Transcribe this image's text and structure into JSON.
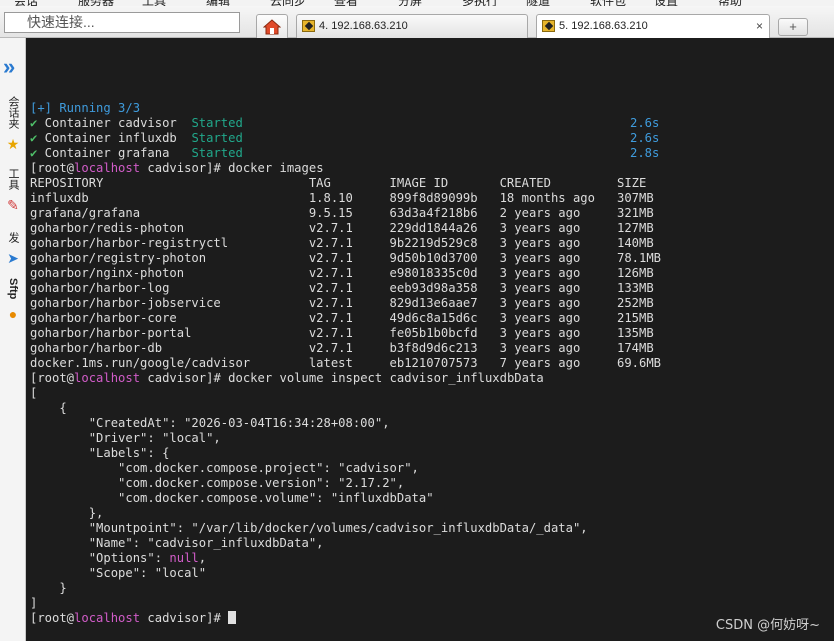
{
  "menubar": [
    "会话",
    "服务器",
    "工具",
    "编辑",
    "云同步",
    "查看",
    "分屏",
    "多执行",
    "隧道",
    "软件包",
    "设置",
    "帮助"
  ],
  "quick_connect": {
    "placeholder": "快速连接..."
  },
  "tabs": [
    {
      "label": "4. 192.168.63.210"
    },
    {
      "label": "5. 192.168.63.210",
      "close": "×"
    }
  ],
  "new_tab_label": "+",
  "sidebar": {
    "collapse_glyph": "»",
    "items": [
      {
        "label": "会话夹",
        "icon": "session-icon"
      },
      {
        "label": "工具",
        "icon": "tool-icon"
      },
      {
        "label": "发",
        "icon": "send-icon"
      },
      {
        "label": "Sftp",
        "icon": "sftp-icon"
      }
    ]
  },
  "terminal": {
    "compose": {
      "status": "[+] Running 3/3",
      "check": "✔",
      "containers": [
        {
          "name": " Container cadvisor  ",
          "state": "Started",
          "time": "2.6s"
        },
        {
          "name": " Container influxdb  ",
          "state": "Started",
          "time": "2.6s"
        },
        {
          "name": " Container grafana   ",
          "state": "Started",
          "time": "2.8s"
        }
      ]
    },
    "prompt": {
      "open": "[root@",
      "host": "localhost",
      "close": " cadvisor]# "
    },
    "cmd_images": "docker images",
    "images_header": "REPOSITORY                            TAG        IMAGE ID       CREATED         SIZE",
    "images": [
      "influxdb                              1.8.10     899f8d89099b   18 months ago   307MB",
      "grafana/grafana                       9.5.15     63d3a4f218b6   2 years ago     321MB",
      "goharbor/redis-photon                 v2.7.1     229dd1844a26   3 years ago     127MB",
      "goharbor/harbor-registryctl           v2.7.1     9b2219d529c8   3 years ago     140MB",
      "goharbor/registry-photon              v2.7.1     9d50b10d3700   3 years ago     78.1MB",
      "goharbor/nginx-photon                 v2.7.1     e98018335c0d   3 years ago     126MB",
      "goharbor/harbor-log                   v2.7.1     eeb93d98a358   3 years ago     133MB",
      "goharbor/harbor-jobservice            v2.7.1     829d13e6aae7   3 years ago     252MB",
      "goharbor/harbor-core                  v2.7.1     49d6c8a15d6c   3 years ago     215MB",
      "goharbor/harbor-portal                v2.7.1     fe05b1b0bcfd   3 years ago     135MB",
      "goharbor/harbor-db                    v2.7.1     b3f8d9d6c213   3 years ago     174MB",
      "docker.1ms.run/google/cadvisor        latest     eb1210707573   7 years ago     69.6MB"
    ],
    "cmd_inspect": "docker volume inspect cadvisor_influxdbData",
    "json_lines": [
      "[",
      "    {",
      "        \"CreatedAt\": \"2026-03-04T16:34:28+08:00\",",
      "        \"Driver\": \"local\",",
      "        \"Labels\": {",
      "            \"com.docker.compose.project\": \"cadvisor\",",
      "            \"com.docker.compose.version\": \"2.17.2\",",
      "            \"com.docker.compose.volume\": \"influxdbData\"",
      "        },",
      "        \"Mountpoint\": \"/var/lib/docker/volumes/cadvisor_influxdbData/_data\",",
      "        \"Name\": \"cadvisor_influxdbData\","
    ],
    "options_line": {
      "pre": "        \"Options\": ",
      "value": "null",
      "post": ","
    },
    "json_tail": [
      "        \"Scope\": \"local\"",
      "    }",
      "]"
    ]
  },
  "watermark": "CSDN @何妨呀~",
  "colors": {
    "terminal_bg": "#1c1c1c",
    "prompt_host": "#d15cc8",
    "running": "#3f9bdc",
    "started": "#21a88b",
    "null_value": "#d15cc8"
  }
}
